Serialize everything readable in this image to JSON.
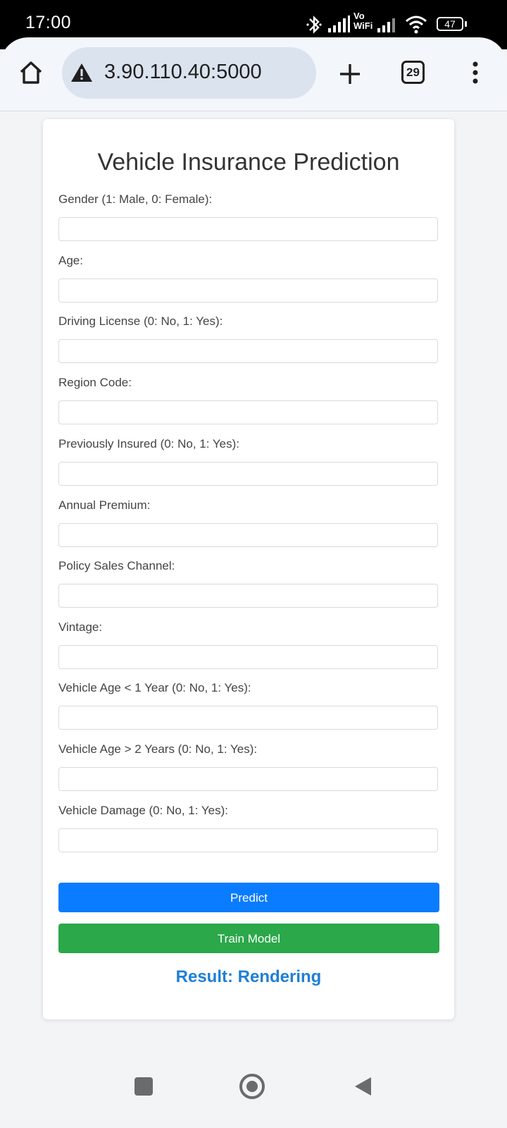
{
  "status_bar": {
    "time": "17:00",
    "vowifi_top": "Vo",
    "vowifi_bottom": "WiFi",
    "battery": "47"
  },
  "browser": {
    "url": "3.90.110.40:5000",
    "tab_count": "29"
  },
  "page": {
    "title": "Vehicle Insurance Prediction",
    "fields": [
      {
        "label": "Gender (1: Male, 0: Female):",
        "value": "",
        "placeholder": ""
      },
      {
        "label": "Age:",
        "value": "",
        "placeholder": ""
      },
      {
        "label": "Driving License (0: No, 1: Yes):",
        "value": "",
        "placeholder": ""
      },
      {
        "label": "Region Code:",
        "value": "",
        "placeholder": ""
      },
      {
        "label": "Previously Insured (0: No, 1: Yes):",
        "value": "",
        "placeholder": ""
      },
      {
        "label": "Annual Premium:",
        "value": "",
        "placeholder": ""
      },
      {
        "label": "Policy Sales Channel:",
        "value": "",
        "placeholder": ""
      },
      {
        "label": "Vintage:",
        "value": "",
        "placeholder": ""
      },
      {
        "label": "Vehicle Age < 1 Year (0: No, 1: Yes):",
        "value": "",
        "placeholder": ""
      },
      {
        "label": "Vehicle Age > 2 Years (0: No, 1: Yes):",
        "value": "",
        "placeholder": ""
      },
      {
        "label": "Vehicle Damage (0: No, 1: Yes):",
        "value": "",
        "placeholder": ""
      }
    ],
    "predict_label": "Predict",
    "train_label": "Train Model",
    "result_text": "Result: Rendering"
  },
  "colors": {
    "predict_button": "#0a7cff",
    "train_button": "#2aa84a",
    "result_text": "#1f7fd6"
  }
}
